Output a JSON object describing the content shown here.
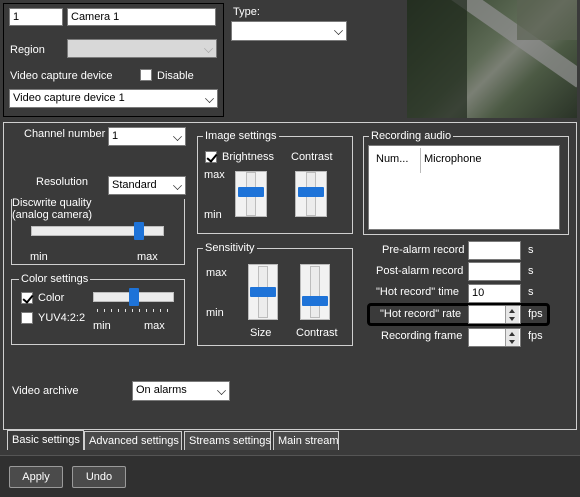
{
  "camera": {
    "number": "1",
    "name": "Camera 1",
    "region_label": "Region",
    "region_value": "",
    "video_capture_label": "Video capture device",
    "disable_label": "Disable",
    "disable_checked": false,
    "device_value": "Video capture device 1",
    "type_label": "Type:",
    "type_value": ""
  },
  "basic": {
    "channel_number_label": "Channel number",
    "channel_number_value": "1",
    "resolution_label": "Resolution",
    "resolution_value": "Standard",
    "discwrite_label_line1": "Discwrite quality",
    "discwrite_label_line2": "(analog camera)",
    "discwrite_min": "min",
    "discwrite_max": "max",
    "discwrite_level": 0.84,
    "color_settings_title": "Color settings",
    "color_label": "Color",
    "color_checked": true,
    "yuv_label": "YUV4:2:2",
    "yuv_checked": false,
    "color_slider_min": "min",
    "color_slider_max": "max",
    "color_slider_level": 0.5
  },
  "image_settings": {
    "title": "Image settings",
    "brightness_label": "Brightness",
    "brightness_checked": true,
    "contrast_label": "Contrast",
    "max_label": "max",
    "min_label": "min",
    "brightness_level": 0.55,
    "contrast_level": 0.55
  },
  "sensitivity": {
    "title": "Sensitivity",
    "max_label": "max",
    "min_label": "min",
    "size_label": "Size",
    "contrast_label": "Contrast",
    "size_level": 0.5,
    "contrast_level": 0.28
  },
  "recording_audio": {
    "title": "Recording audio",
    "col_num": "Num...",
    "col_mic": "Microphone"
  },
  "recording": {
    "pre_alarm_label": "Pre-alarm record",
    "pre_alarm_value": "",
    "pre_alarm_unit": "s",
    "post_alarm_label": "Post-alarm record",
    "post_alarm_value": "",
    "post_alarm_unit": "s",
    "hot_time_label": "\"Hot record\" time",
    "hot_time_value": "10",
    "hot_time_unit": "s",
    "hot_rate_label": "\"Hot record\" rate",
    "hot_rate_value": "",
    "hot_rate_unit": "fps",
    "frame_label": "Recording frame",
    "frame_value": "",
    "frame_unit": "fps"
  },
  "archive": {
    "label": "Video archive",
    "value": "On alarms"
  },
  "tabs": [
    "Basic settings",
    "Advanced settings",
    "Streams settings",
    "Main stream"
  ],
  "buttons": {
    "apply": "Apply",
    "undo": "Undo"
  },
  "colors": {
    "background": "#3a3a3a",
    "slider_thumb": "#1e73d8",
    "highlight_border": "#000000"
  }
}
